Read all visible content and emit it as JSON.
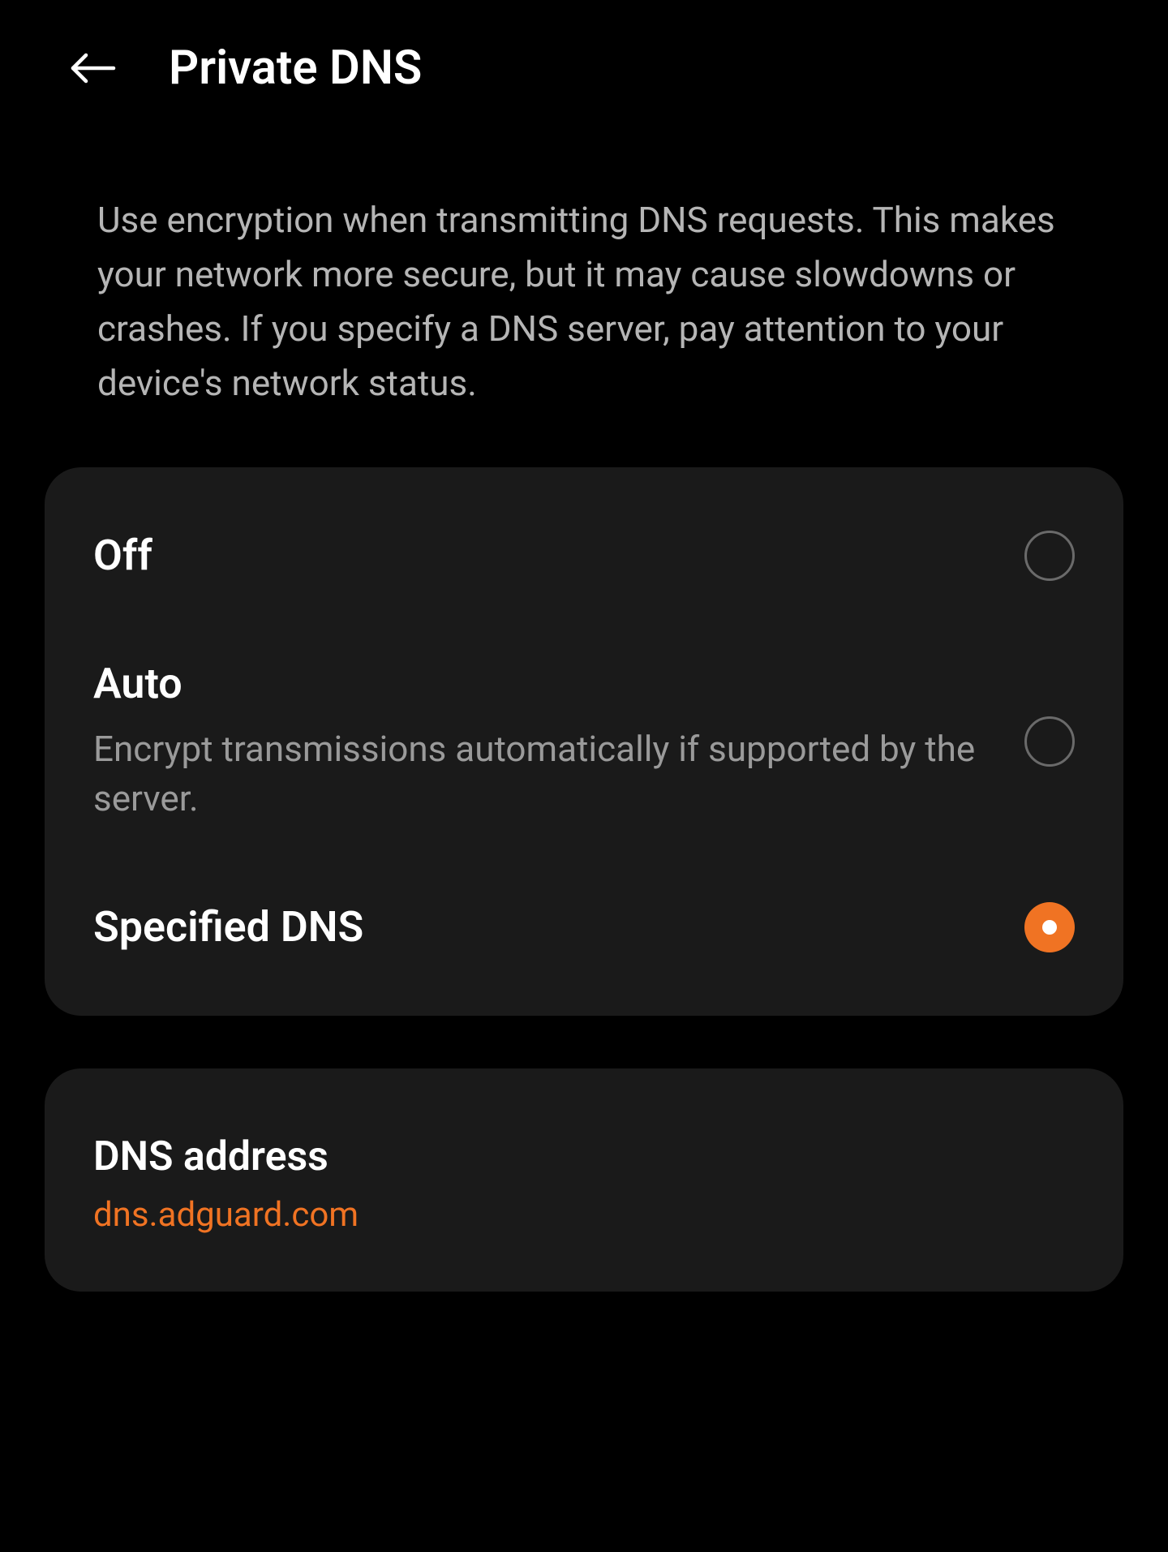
{
  "header": {
    "title": "Private DNS"
  },
  "description": "Use encryption when transmitting DNS requests. This makes your network more secure, but it may cause slowdowns or crashes. If you specify a DNS server, pay attention to your device's network status.",
  "options": {
    "off": {
      "title": "Off",
      "selected": false
    },
    "auto": {
      "title": "Auto",
      "subtitle": "Encrypt transmissions automatically if supported by the server.",
      "selected": false
    },
    "specified": {
      "title": "Specified DNS",
      "selected": true
    }
  },
  "dns_address": {
    "label": "DNS address",
    "value": "dns.adguard.com"
  },
  "colors": {
    "accent": "#f07323",
    "background": "#000000",
    "card": "#1a1a1a",
    "text_primary": "#ffffff",
    "text_secondary": "#9a9a9a"
  }
}
